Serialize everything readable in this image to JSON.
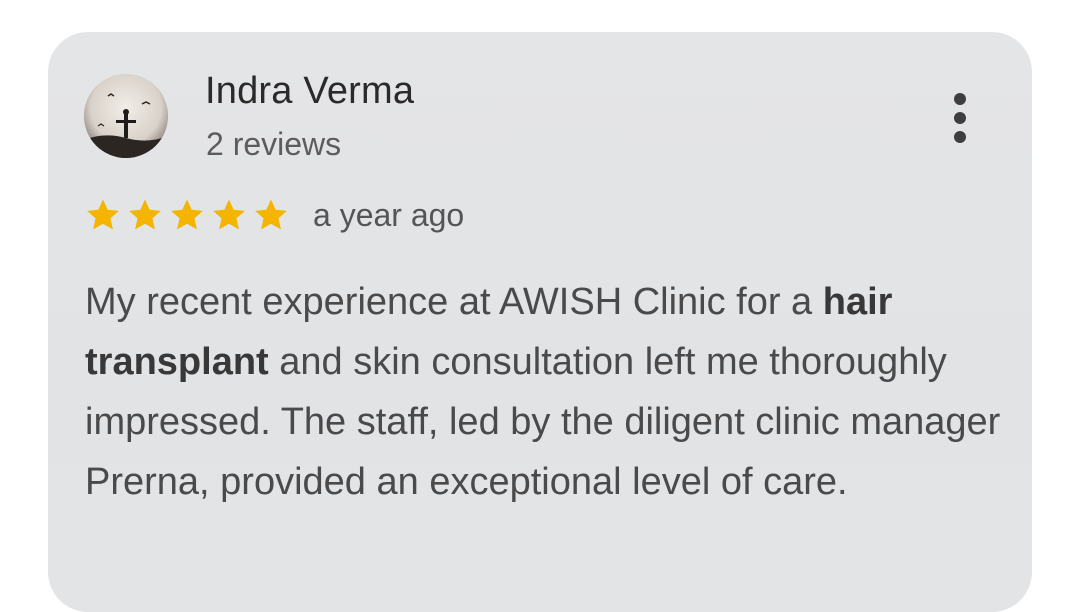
{
  "review": {
    "author": "Indra Verma",
    "review_count": "2 reviews",
    "rating": 5,
    "rating_max": 5,
    "time": "a year ago",
    "text": {
      "part1": "My recent experience at AWISH Clinic for a ",
      "bold1": "hair transplant",
      "part2": " and skin consultation left me thoroughly impressed. The staff, led by the diligent clinic manager Prerna, provided an exceptional level of care."
    }
  },
  "icons": {
    "avatar": "avatar-silhouette",
    "more": "more-vert-icon",
    "star": "star-icon"
  },
  "colors": {
    "star": "#f4b400",
    "card_background": "#e3e4e6"
  }
}
